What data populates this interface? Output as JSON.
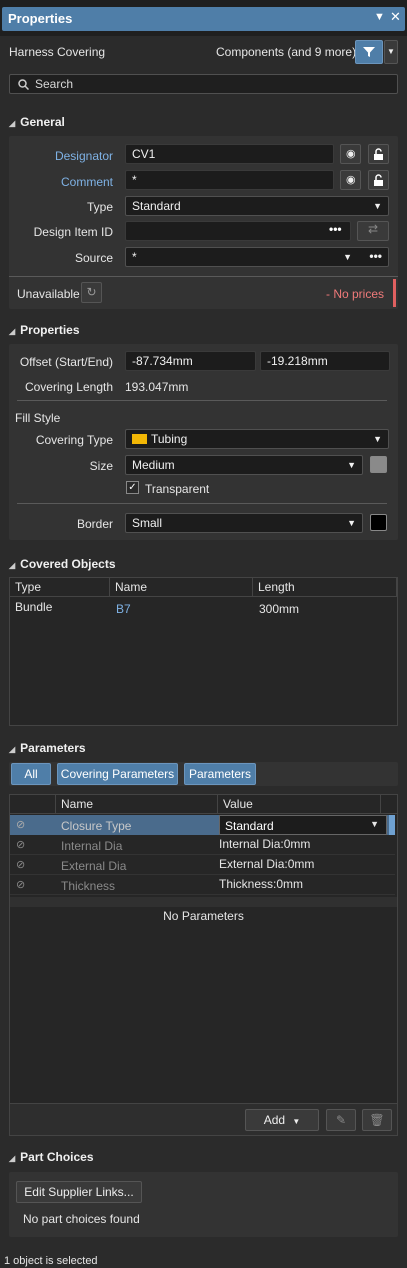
{
  "window": {
    "title": "Properties",
    "menu_icon": "dropdown-arrow-icon",
    "close_icon": "close-icon"
  },
  "header": {
    "object_type": "Harness Covering",
    "filter_label": "Components (and 9 more)"
  },
  "search": {
    "placeholder": "Search"
  },
  "general": {
    "title": "General",
    "designator_label": "Designator",
    "designator_value": "CV1",
    "comment_label": "Comment",
    "comment_value": "*",
    "type_label": "Type",
    "type_value": "Standard",
    "design_item_label": "Design Item ID",
    "design_item_value": "",
    "source_label": "Source",
    "source_value": "*",
    "availability_label": "Unavailable",
    "price_label": "- No prices"
  },
  "properties": {
    "title": "Properties",
    "offset_label": "Offset (Start/End)",
    "offset_start": "-87.734mm",
    "offset_end": "-19.218mm",
    "length_label": "Covering Length",
    "length_value": "193.047mm",
    "fill_style_label": "Fill Style",
    "covering_type_label": "Covering Type",
    "covering_type_value": "Tubing",
    "covering_color": "#f2b705",
    "size_label": "Size",
    "size_value": "Medium",
    "size_color": "#8a8a8a",
    "transparent_label": "Transparent",
    "transparent_checked": true,
    "border_label": "Border",
    "border_value": "Small",
    "border_color": "#000000"
  },
  "covered_objects": {
    "title": "Covered Objects",
    "columns": [
      "Type",
      "Name",
      "Length"
    ],
    "rows": [
      {
        "type": "Bundle",
        "name": "B7",
        "length": "300mm"
      }
    ]
  },
  "parameters": {
    "title": "Parameters",
    "filters": [
      "All",
      "Covering Parameters",
      "Parameters"
    ],
    "columns": [
      "Name",
      "Value"
    ],
    "rows": [
      {
        "name": "Closure Type",
        "value": "Standard"
      },
      {
        "name": "Internal Dia",
        "value": "Internal Dia:0mm"
      },
      {
        "name": "External Dia",
        "value": "External Dia:0mm"
      },
      {
        "name": "Thickness",
        "value": "Thickness:0mm"
      }
    ],
    "empty_text": "No Parameters",
    "add_label": "Add"
  },
  "part_choices": {
    "title": "Part Choices",
    "edit_button": "Edit Supplier Links...",
    "empty_text": "No part choices found"
  },
  "status": {
    "text": "1 object is selected"
  }
}
